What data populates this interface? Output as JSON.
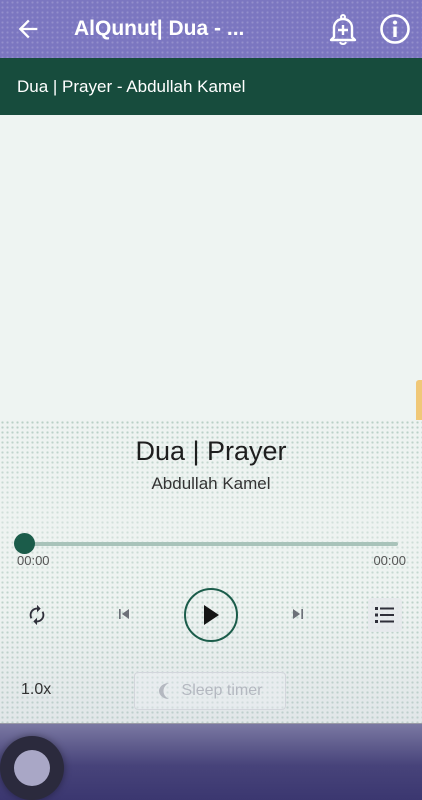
{
  "appbar": {
    "title": "AlQunut| Dua - ...",
    "back_icon": "arrow-left-icon",
    "bell_icon": "bell-plus-icon",
    "info_icon": "info-icon",
    "color": "#7b76c0"
  },
  "subheader": {
    "text": "Dua | Prayer - Abdullah Kamel",
    "color": "#174c3d"
  },
  "player": {
    "title": "Dua | Prayer",
    "artist": "Abdullah Kamel",
    "current_time": "00:00",
    "total_time": "00:00",
    "progress": 0,
    "speed": "1.0x",
    "sleep_label": "Sleep timer",
    "accent_color": "#1b5c4a",
    "controls": [
      "repeat-icon",
      "skip-previous-icon",
      "play-icon",
      "skip-next-icon",
      "queue-list-icon"
    ]
  }
}
